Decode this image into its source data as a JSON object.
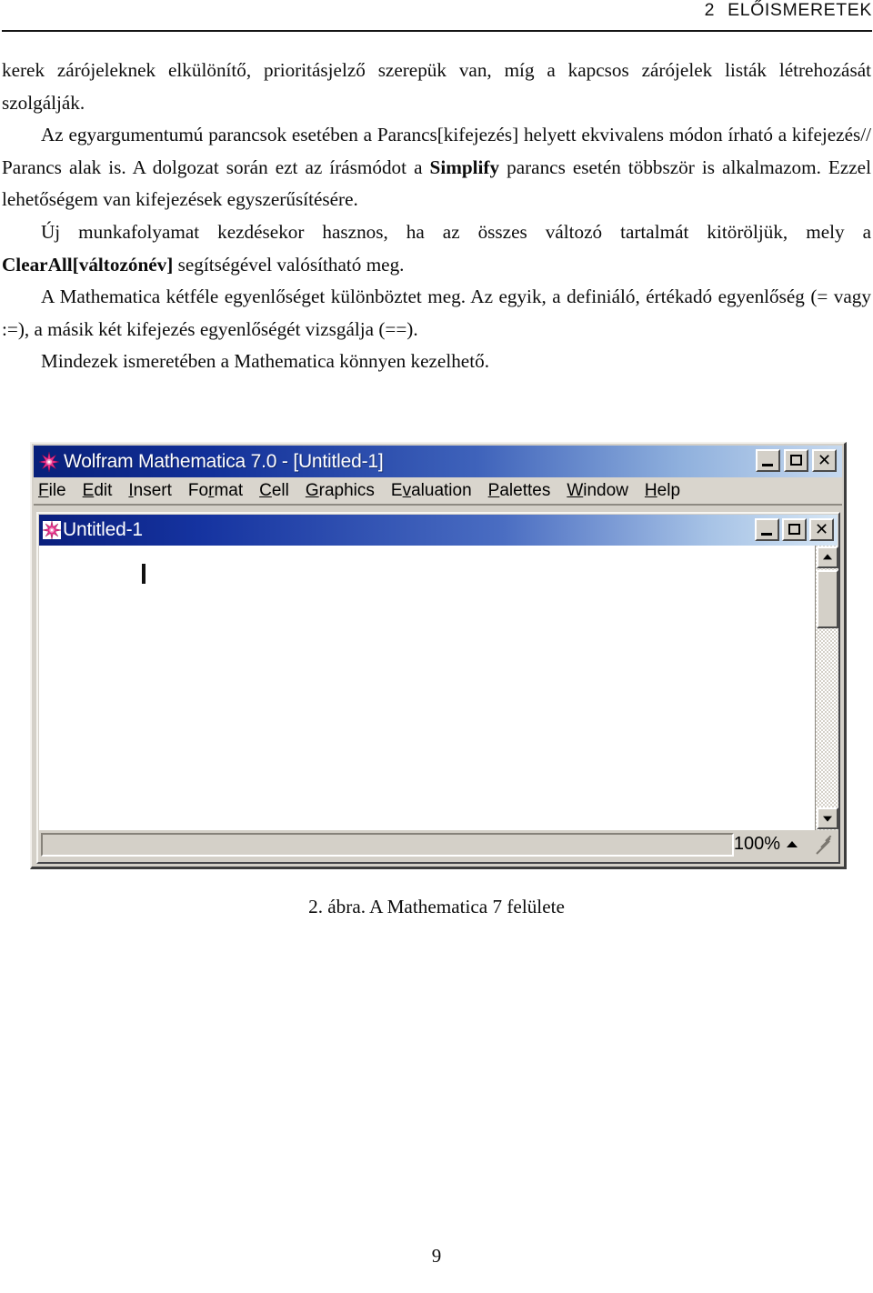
{
  "page": {
    "header": {
      "section_number": "2",
      "section_title": "ELŐISMERETEK"
    },
    "page_number": "9"
  },
  "body": {
    "paragraphs": [
      {
        "id": "p1",
        "indent": false,
        "runs": [
          {
            "text": "kerek zárójeleknek elkülönítő, prioritásjelző szerepük van, míg a kapcsos zárójelek listák létrehozását szolgálják.",
            "bold": false
          }
        ]
      },
      {
        "id": "p2",
        "indent": true,
        "runs": [
          {
            "text": "Az egyargumentumú parancsok esetében a Parancs[kifejezés] helyett ekvivalens módon írható a kifejezés// Parancs alak is. A dolgozat során ezt az írásmódot a ",
            "bold": false
          },
          {
            "text": "Simplify",
            "bold": true
          },
          {
            "text": " parancs esetén többször is alkalmazom. Ezzel lehetőségem van kifejezések egyszerűsítésére.",
            "bold": false
          }
        ]
      },
      {
        "id": "p3",
        "indent": true,
        "runs": [
          {
            "text": "Új munkafolyamat kezdésekor hasznos, ha az összes változó tartalmát kitöröljük, mely a ",
            "bold": false
          },
          {
            "text": "ClearAll[változónév]",
            "bold": true
          },
          {
            "text": " segítségével valósítható meg.",
            "bold": false
          }
        ]
      },
      {
        "id": "p4",
        "indent": true,
        "runs": [
          {
            "text": "A Mathematica kétféle egyenlőséget különböztet meg. Az egyik, a definiáló, értékadó egyenlőség (= vagy :=), a másik két kifejezés egyenlőségét vizsgálja (==).",
            "bold": false
          }
        ]
      },
      {
        "id": "p5",
        "indent": true,
        "runs": [
          {
            "text": "Mindezek ismeretében a Mathematica könnyen kezelhető.",
            "bold": false
          }
        ]
      }
    ]
  },
  "figure": {
    "caption": "2. ábra. A Mathematica 7 felülete",
    "app_window": {
      "title": "Wolfram Mathematica 7.0 - [Untitled-1]",
      "icon": "mathematica-spikey-icon",
      "window_buttons": {
        "minimize": "_",
        "maximize": "□",
        "close": "X"
      },
      "menubar": [
        {
          "label": "File",
          "mnemonic_index": 0
        },
        {
          "label": "Edit",
          "mnemonic_index": 0
        },
        {
          "label": "Insert",
          "mnemonic_index": 0
        },
        {
          "label": "Format",
          "mnemonic_index": 2
        },
        {
          "label": "Cell",
          "mnemonic_index": 0
        },
        {
          "label": "Graphics",
          "mnemonic_index": 0
        },
        {
          "label": "Evaluation",
          "mnemonic_index": 1
        },
        {
          "label": "Palettes",
          "mnemonic_index": 0
        },
        {
          "label": "Window",
          "mnemonic_index": 0
        },
        {
          "label": "Help",
          "mnemonic_index": 0
        }
      ]
    },
    "document_window": {
      "title": "Untitled-1",
      "icon": "mathematica-spikey-icon",
      "window_buttons": {
        "minimize": "_",
        "maximize": "□",
        "close": "X"
      },
      "notebook_content": "",
      "statusbar": {
        "message": "",
        "zoom_level": "100%"
      }
    },
    "colors": {
      "titlebar_start": "#08207a",
      "titlebar_end": "#c6d9ef",
      "chrome_face": "#d4d0c8",
      "canvas": "#ffffff",
      "spikey": "#e8308a"
    }
  }
}
